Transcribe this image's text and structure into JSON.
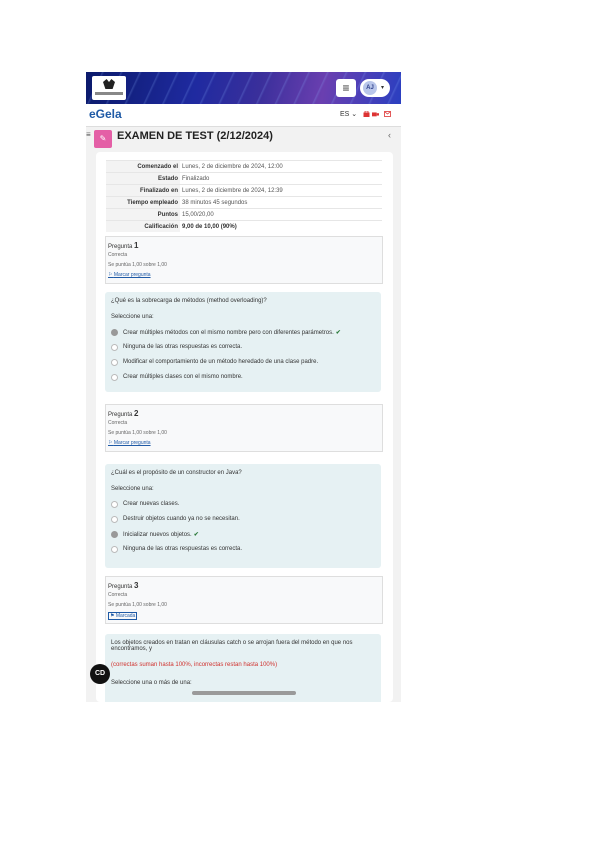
{
  "header": {
    "brand": "eGela",
    "lang": "ES ⌄",
    "menu_icon": "hamburger-icon",
    "user_initials": "AJ",
    "user_caret": "▾"
  },
  "page": {
    "title": "EXAMEN DE TEST (2/12/2024)",
    "quiz_icon": "✎",
    "collapse": "‹",
    "sidebar": "≡"
  },
  "summary": [
    {
      "label": "Comenzado el",
      "value": "Lunes, 2 de diciembre de 2024, 12:00"
    },
    {
      "label": "Estado",
      "value": "Finalizado"
    },
    {
      "label": "Finalizado en",
      "value": "Lunes, 2 de diciembre de 2024, 12:39"
    },
    {
      "label": "Tiempo empleado",
      "value": "38 minutos 45 segundos"
    },
    {
      "label": "Puntos",
      "value": "15,00/20,00"
    },
    {
      "label": "Calificación",
      "value": "9,00 de 10,00 (90%)"
    }
  ],
  "questions": [
    {
      "prefix": "Pregunta",
      "number": "1",
      "state": "Correcta",
      "points": "Se puntúa 1,00 sobre 1,00",
      "flag": "Marcar pregunta",
      "prompt": "¿Qué es la sobrecarga de métodos (method overloading)?",
      "select": "Seleccione una:",
      "options": [
        "Crear múltiples métodos con el mismo nombre pero con diferentes parámetros.",
        "Ninguna de las otras respuestas es correcta.",
        "Modificar el comportamiento de un método heredado de una clase padre.",
        "Crear múltiples clases con el mismo nombre."
      ],
      "check": "✔"
    },
    {
      "prefix": "Pregunta",
      "number": "2",
      "state": "Correcta",
      "points": "Se puntúa 1,00 sobre 1,00",
      "flag": "Marcar pregunta",
      "prompt": "¿Cuál es el propósito de un constructor en Java?",
      "select": "Seleccione una:",
      "options": [
        "Crear nuevas clases.",
        "Destruir objetos cuando ya no se necesitan.",
        "Inicializar nuevos objetos.",
        "Ninguna de las otras respuestas es correcta."
      ],
      "check": "✔"
    },
    {
      "prefix": "Pregunta",
      "number": "3",
      "state": "Correcta",
      "points": "Se puntúa 1,00 sobre 1,00",
      "flag": "Marcada",
      "prompt": "Los objetos creados en tratan en cláusulas catch o se arrojan fuera del método en que nos encontramos, y",
      "feedback": "(correctas suman hasta 100%, incorrectas restan hasta 100%)",
      "select": "Seleccione una o más de una:"
    }
  ],
  "fab": "CD"
}
